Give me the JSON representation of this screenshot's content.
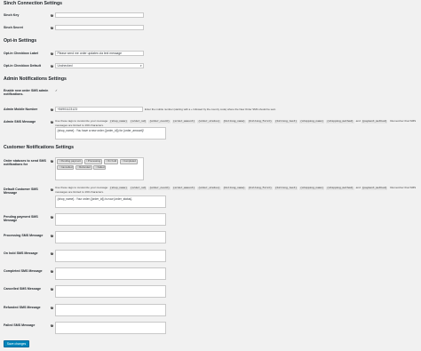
{
  "sections": {
    "sinch": "Sinch Connection Settings",
    "optin": "Opt-in Settings",
    "admin": "Admin Notifications Settings",
    "customer": "Customer Notifications Settings"
  },
  "sinch": {
    "key_label": "Sinch Key",
    "key_value": "",
    "secret_label": "Sinch Secret",
    "secret_value": ""
  },
  "optin": {
    "checkbox_label_label": "Opt-in Checkbox Label",
    "checkbox_label_value": "Please send me order updates via text message",
    "default_label": "Opt-in Checkbox Default",
    "default_value": "Unchecked"
  },
  "admin": {
    "enable_label": "Enable new order SMS admin notifications.",
    "enable_checked": true,
    "mobile_label": "Admin Mobile Number",
    "mobile_value": "+84901123123",
    "mobile_hint": "Enter the mobile number (starting with a + followed by the country code) where the New Order SMS should be sent.",
    "message_label": "Admin SMS Message",
    "message_help_prefix": "Use these tags to customize your message:",
    "message_tags": [
      "{shop_name}",
      "{order_id}",
      "{order_count}",
      "{order_amount}",
      "{order_status}",
      "{billing_name}",
      "{billing_first}",
      "{billing_last}",
      "{shipping_name}",
      "{shipping_method}",
      "and",
      "{payment_method}"
    ],
    "message_help_suffix": "Remember that SMS messages are limited to 160 characters.",
    "message_value": "{shop_name} : You have a new order ({order_id}) for {order_amount}!"
  },
  "customer": {
    "statuses_label": "Order statuses to send SMS notifications for",
    "statuses": [
      "Pending payment",
      "Processing",
      "On hold",
      "Completed",
      "Cancelled",
      "Refunded",
      "Failed"
    ],
    "default_label": "Default Customer SMS Message",
    "default_help_prefix": "Use these tags to customize your message:",
    "default_tags": [
      "{shop_name}",
      "{order_id}",
      "{order_count}",
      "{order_amount}",
      "{order_status}",
      "{billing_name}",
      "{billing_first}",
      "{billing_last}",
      "{shipping_name}",
      "{shipping_method}",
      "and",
      "{payment_method}"
    ],
    "default_help_suffix": "Remember that SMS messages are limited to 160 characters.",
    "default_value": "{shop_name} : Your order ({order_id}) is now {order_status}.",
    "pending_label": "Pending payment SMS Message",
    "processing_label": "Processing SMS Message",
    "onhold_label": "On hold SMS Message",
    "completed_label": "Completed SMS Message",
    "cancelled_label": "Cancelled SMS Message",
    "refunded_label": "Refunded SMS Message",
    "failed_label": "Failed SMS Message"
  },
  "save_button": "Save changes",
  "icons": {
    "help": "help-icon",
    "dropdown": "chevron-down-icon",
    "remove": "remove-icon"
  }
}
